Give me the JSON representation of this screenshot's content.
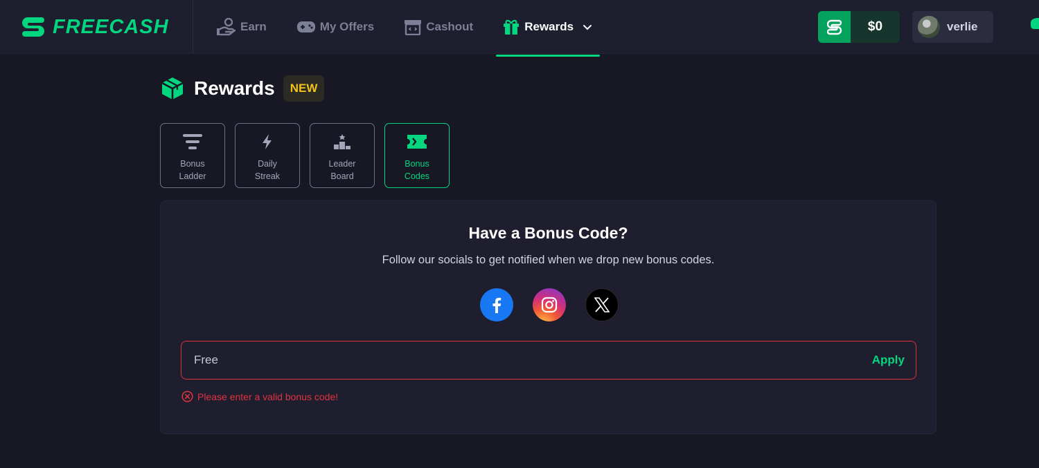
{
  "brand": {
    "part1": "FREE",
    "part2": "CASH"
  },
  "nav": {
    "items": [
      {
        "label": "Earn",
        "icon": "hand-coin-icon"
      },
      {
        "label": "My Offers",
        "icon": "gamepad-icon"
      },
      {
        "label": "Cashout",
        "icon": "register-icon"
      },
      {
        "label": "Rewards",
        "icon": "gift-icon",
        "active": true
      }
    ]
  },
  "balance": {
    "amount": "$0",
    "icon": "exchange-icon"
  },
  "user": {
    "name": "verlie"
  },
  "page": {
    "title": "Rewards",
    "badge": "NEW"
  },
  "tabs": [
    {
      "label": "Bonus\nLadder",
      "icon": "ladder-icon"
    },
    {
      "label": "Daily\nStreak",
      "icon": "lightning-icon"
    },
    {
      "label": "Leader\nBoard",
      "icon": "podium-icon"
    },
    {
      "label": "Bonus\nCodes",
      "icon": "ticket-icon",
      "active": true
    }
  ],
  "bonus_code": {
    "title": "Have a Bonus Code?",
    "subtitle": "Follow our socials to get notified when we drop new bonus codes.",
    "socials": [
      "facebook",
      "instagram",
      "x"
    ],
    "input_value": "Free",
    "apply_label": "Apply",
    "error": "Please enter a valid bonus code!"
  },
  "colors": {
    "accent": "#03d67f",
    "error": "#e0343f",
    "badge": "#f2c21b",
    "background": "#181825",
    "card": "#1e1e2f"
  }
}
